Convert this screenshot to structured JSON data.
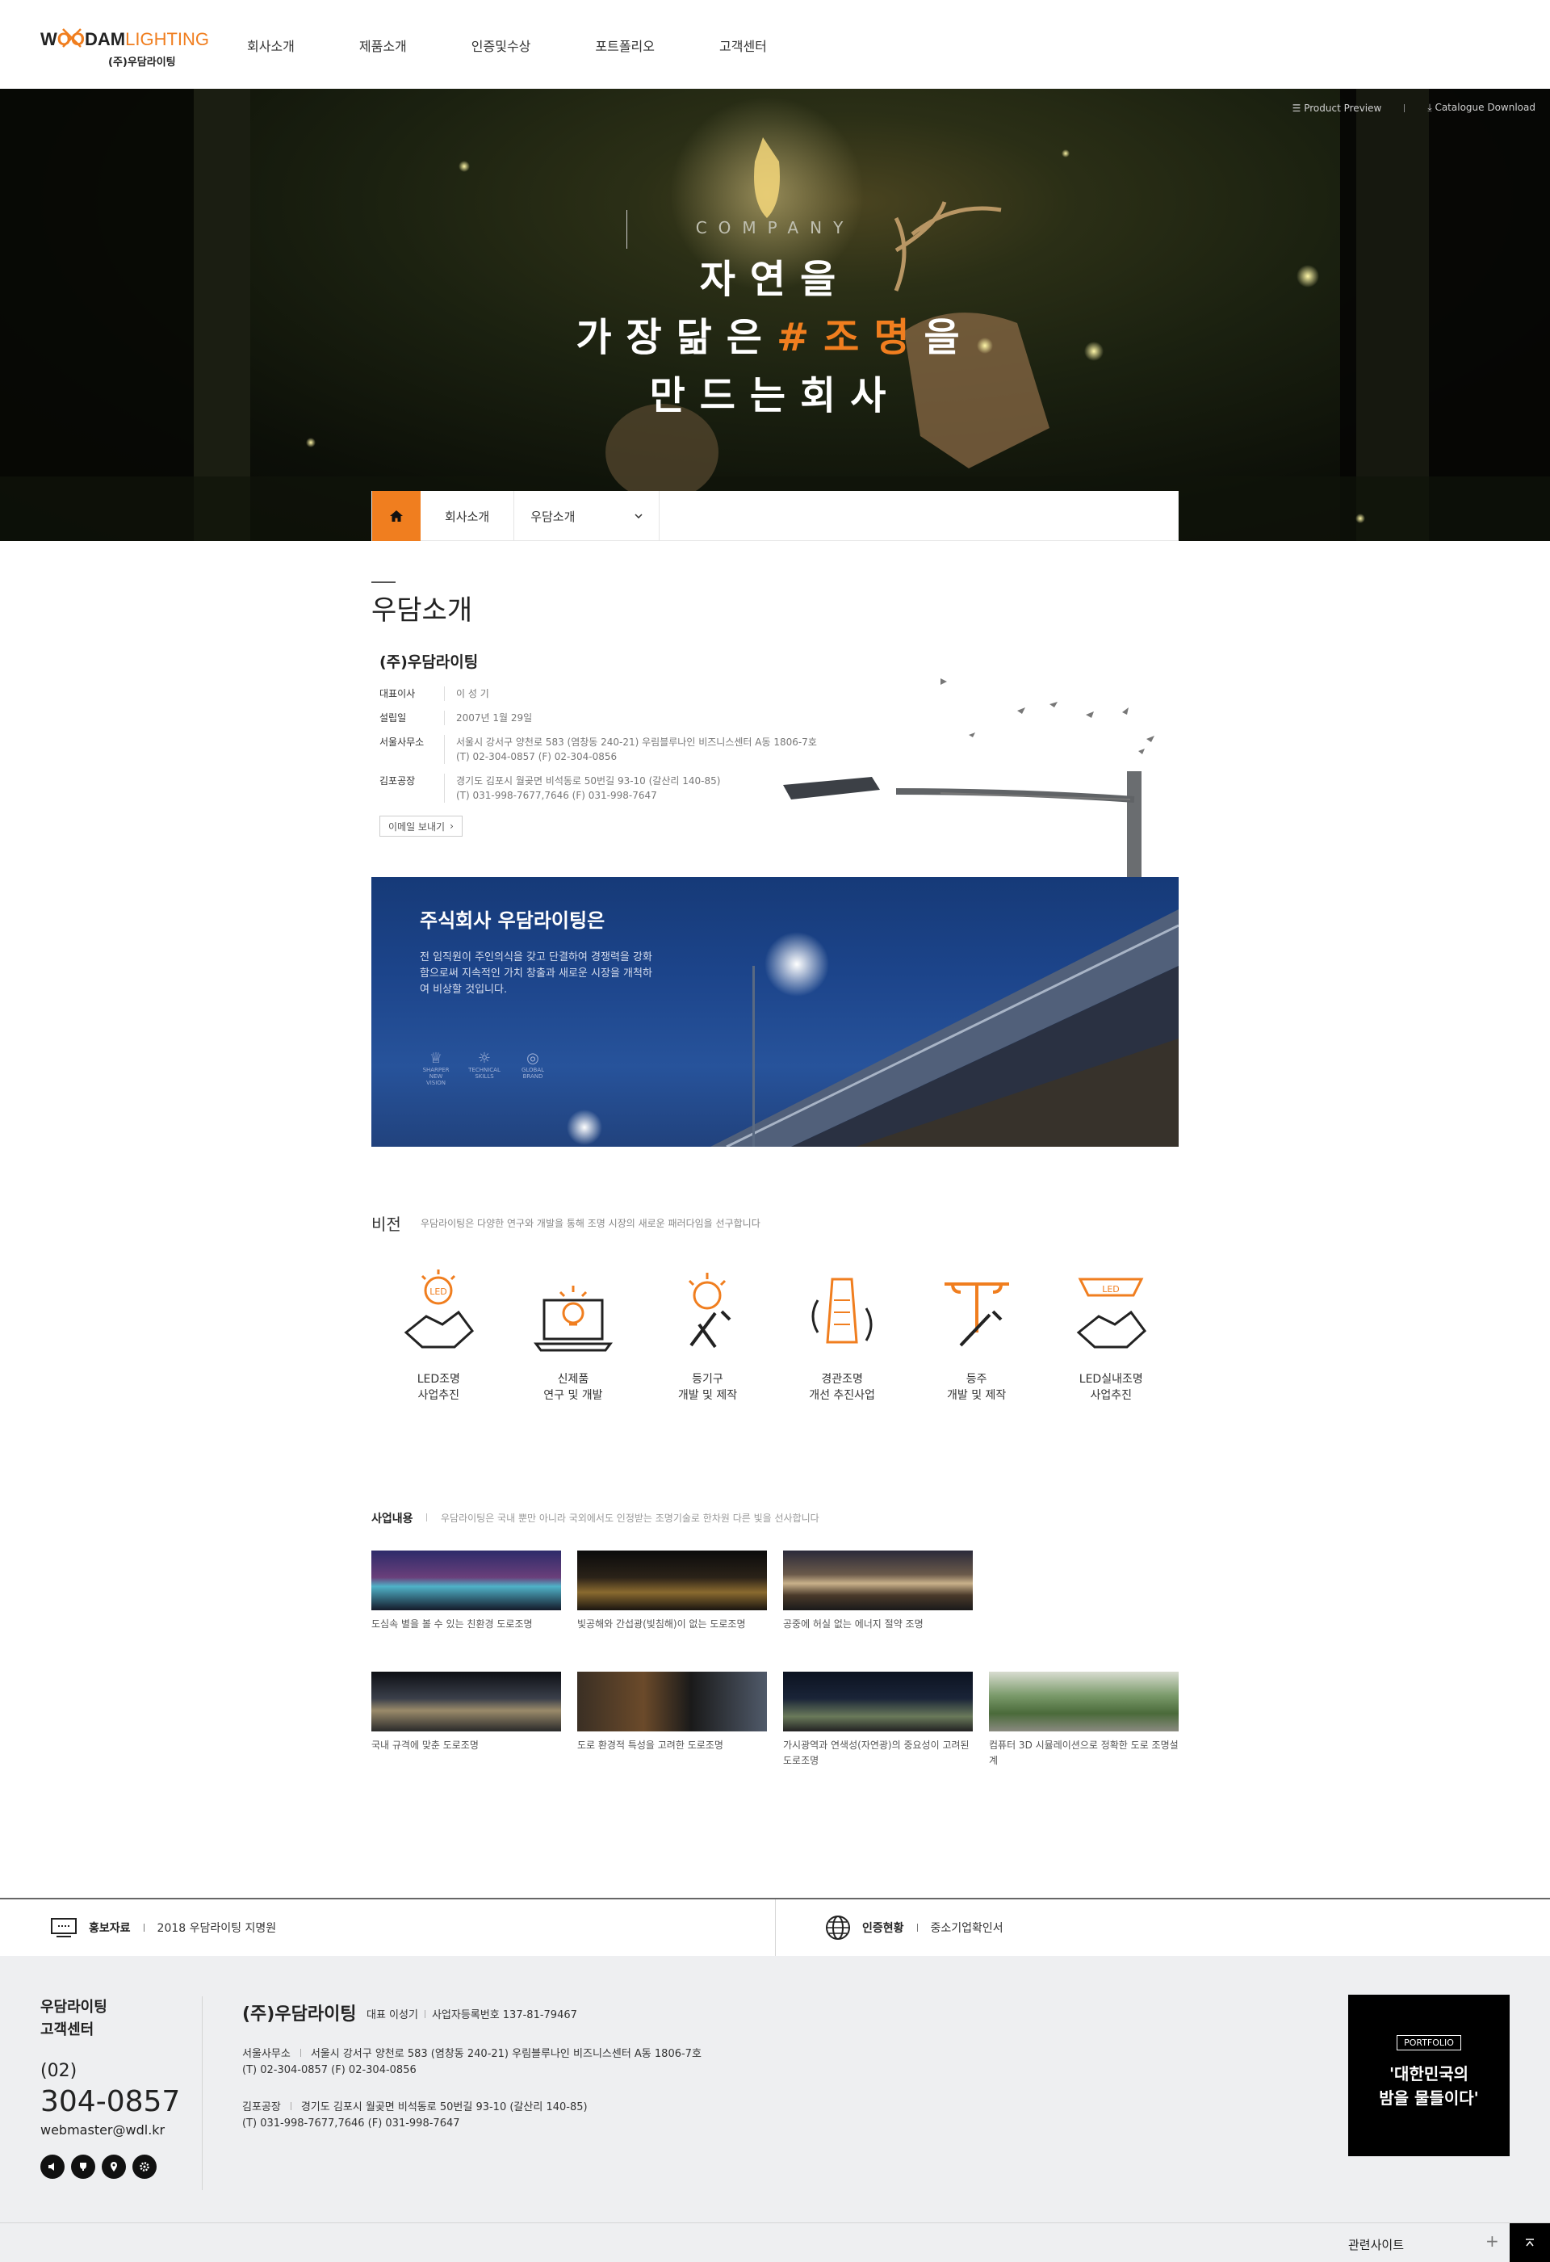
{
  "header": {
    "logo_en_w": "W",
    "logo_en_oo": "OO",
    "logo_en_dam": "DAM",
    "logo_en_lighting": "LIGHTING",
    "logo_ko": "(주)우담라이팅",
    "nav": [
      "회사소개",
      "제품소개",
      "인증및수상",
      "포트폴리오",
      "고객센터"
    ]
  },
  "hero": {
    "product_preview": "Product Preview",
    "catalogue": "Catalogue Download",
    "company": "COMPANY",
    "line1": "자연을",
    "line2_a": "가장닮은",
    "line2_accent": "#조명",
    "line2_b": "을",
    "line3": "만드는회사"
  },
  "breadcrumb": {
    "home_icon": "home-icon",
    "item1": "회사소개",
    "item2": "우담소개"
  },
  "intro": {
    "section_title": "우담소개",
    "company_name": "(주)우담라이팅",
    "rows": [
      {
        "label": "대표이사",
        "value": "이 성 기"
      },
      {
        "label": "설립일",
        "value": "2007년 1월 29일"
      },
      {
        "label": "서울사무소",
        "value": "서울시 강서구 양천로 583 (염창동 240-21) 우림블루나인 비즈니스센터 A동 1806-7호",
        "value2": "(T) 02-304-0857  (F) 02-304-0856"
      },
      {
        "label": "김포공장",
        "value": "경기도 김포시 월곶면 비석동로 50번길 93-10 (갈산리 140-85)",
        "value2": "(T) 031-998-7677,7646  (F) 031-998-7647"
      }
    ],
    "email_button": "이메일 보내기"
  },
  "bridge": {
    "title": "주식회사 우담라이팅은",
    "text": "전 임직원이 주인의식을 갖고 단결하여 경쟁력을 강화함으로써 지속적인 가치 창출과 새로운 시장을 개척하여 비상할 것입니다.",
    "badges": [
      "SHARPER NEW VISION",
      "TECHNICAL SKILLS",
      "GLOBAL BRAND"
    ]
  },
  "vision": {
    "title": "비전",
    "desc": "우담라이팅은 다양한 연구와 개발을 통해 조명 시장의 새로운 패러다임을 선구합니다",
    "items": [
      {
        "label": "LED조명\n사업추진",
        "icon": "led-handshake-icon"
      },
      {
        "label": "신제품\n연구 및 개발",
        "icon": "laptop-bulb-icon"
      },
      {
        "label": "등기구\n개발 및 제작",
        "icon": "bulb-wrench-icon"
      },
      {
        "label": "경관조명\n개선 추진사업",
        "icon": "landscape-light-icon"
      },
      {
        "label": "등주\n개발 및 제작",
        "icon": "pole-wrench-icon"
      },
      {
        "label": "LED실내조명\n사업추진",
        "icon": "led-lamp-handshake-icon"
      }
    ]
  },
  "business": {
    "title": "사업내용",
    "desc": "우담라이팅은 국내 뿐만 아니라 국외에서도 인정받는 조명기술로 한차원 다른 빛을 선사합니다",
    "items": [
      {
        "caption": "도심속 별을 볼 수 있는 친환경 도로조명"
      },
      {
        "caption": "빛공해와 간섭광(빛침해)이 없는 도로조명"
      },
      {
        "caption": "공중에 허실 없는 에너지 절약 조명"
      },
      {
        "caption": "국내 규격에 맞춘 도로조명"
      },
      {
        "caption": "도로 환경적 특성을 고려한 도로조명"
      },
      {
        "caption": "가시광역과 연색성(자연광)의 중요성이 고려된 도로조명"
      },
      {
        "caption": "컴퓨터 3D 시뮬레이션으로 정확한 도로 조명설계"
      }
    ]
  },
  "bottom_bar": {
    "pr_label": "홍보자료",
    "pr_value": "2018 우담라이팅 지명원",
    "cert_label": "인증현황",
    "cert_value": "중소기업확인서"
  },
  "footer": {
    "cs_title1": "우담라이팅",
    "cs_title2": "고객센터",
    "area": "(02)",
    "phone": "304-0857",
    "email": "webmaster@wdl.kr",
    "company": "(주)우담라이팅",
    "ceo": "대표 이성기",
    "biz_no": "사업자등록번호 137-81-79467",
    "seoul_label": "서울사무소",
    "seoul_addr": "서울시 강서구 양천로 583 (염창동 240-21) 우림블루나인 비즈니스센터 A동 1806-7호",
    "seoul_tel": "(T) 02-304-0857  (F) 02-304-0856",
    "gimpo_label": "김포공장",
    "gimpo_addr": "경기도 김포시 월곶면 비석동로 50번길 93-10 (갈산리 140-85)",
    "gimpo_tel": "(T) 031-998-7677,7646  (F) 031-998-7647",
    "portfolio_tag": "PORTFOLIO",
    "portfolio_line1": "'대한민국의",
    "portfolio_line2": "밤을 물들이다'",
    "related": "관련사이트"
  },
  "colors": {
    "accent": "#f07e1f",
    "dark": "#222222",
    "footer_bg": "#eeeff1",
    "bridge": "#1c448a"
  }
}
